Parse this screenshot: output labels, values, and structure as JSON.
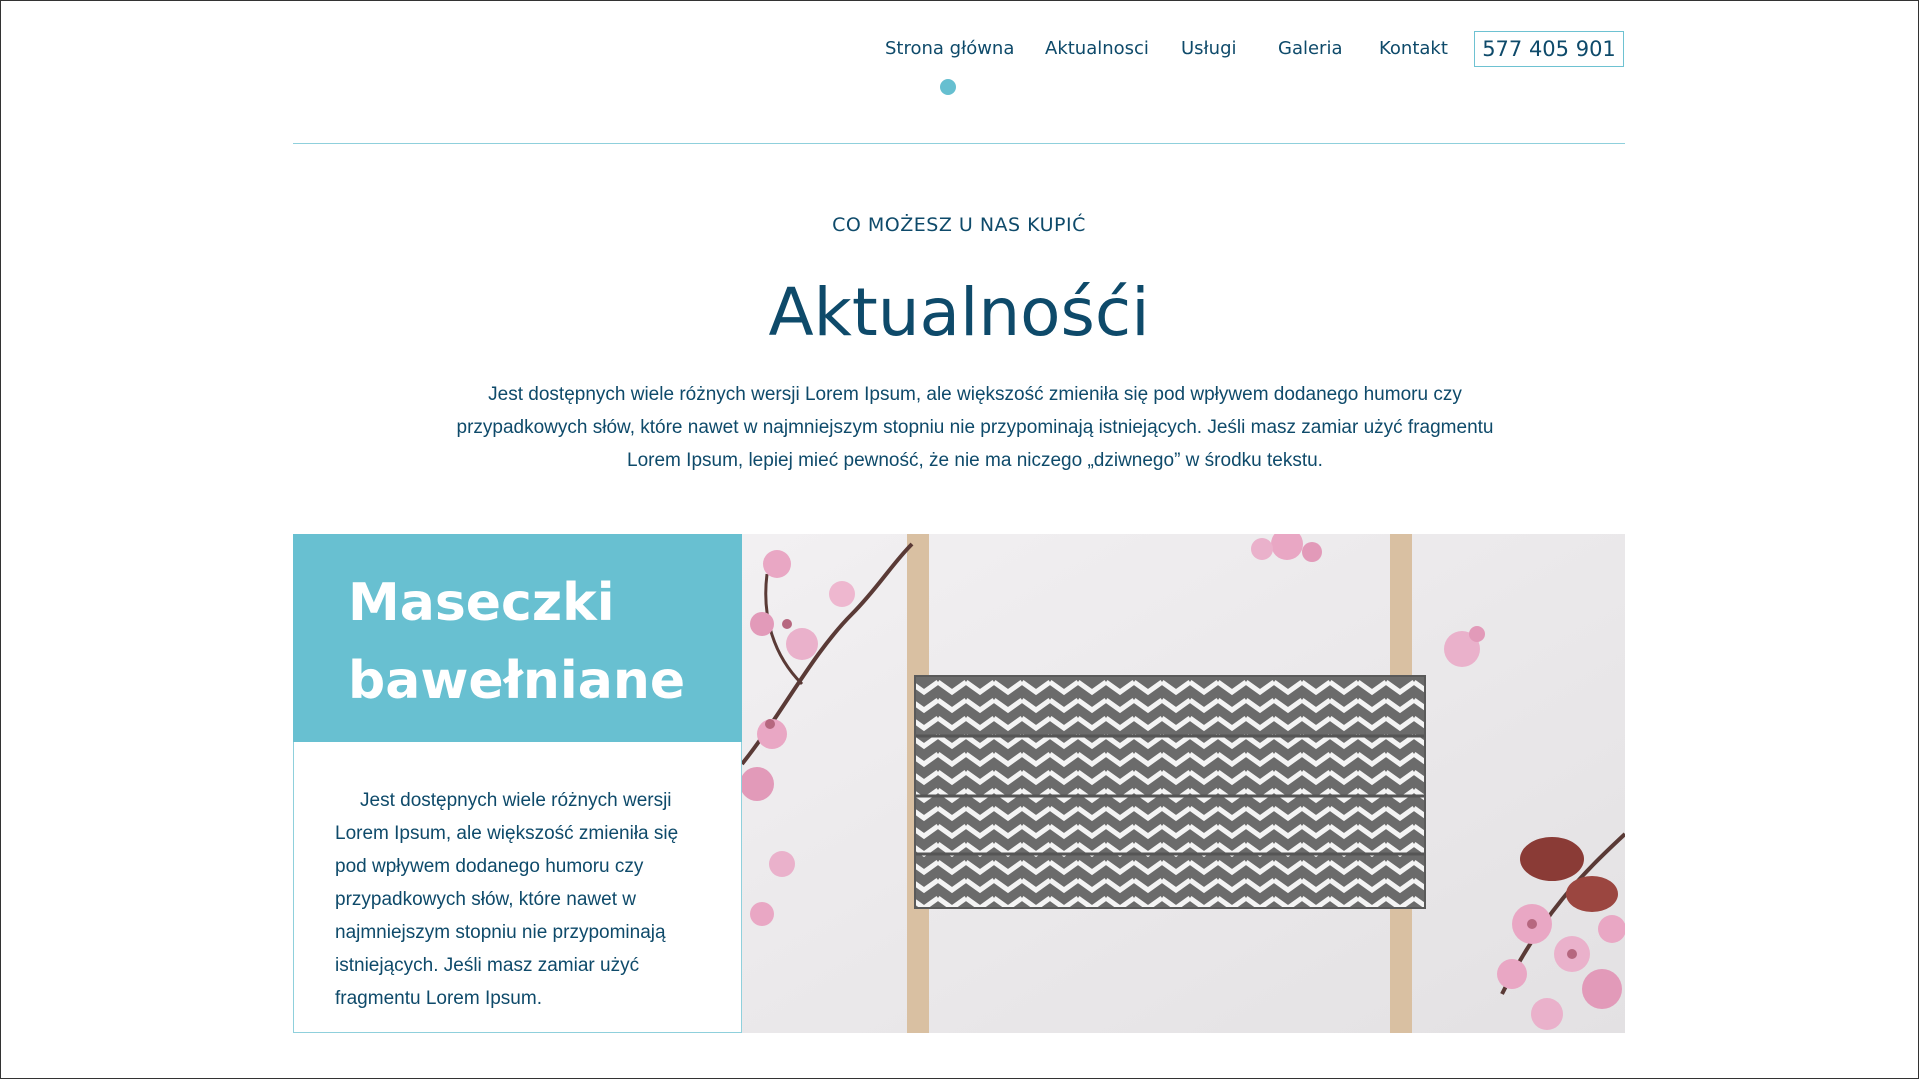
{
  "nav": {
    "items": [
      "Strona główna",
      "Aktualnosci",
      "Usługi",
      "Galeria",
      "Kontakt"
    ],
    "phone": "577 405 901",
    "active_index": 0
  },
  "intro": {
    "eyebrow": "CO MOŻESZ U NAS KUPIĆ",
    "title": "Aktualnośći",
    "text": "Jest dostępnych wiele różnych wersji Lorem Ipsum, ale większość zmieniła się pod wpływem dodanego humoru czy przypadkowych słów, które nawet w najmniejszym stopniu nie przypominają istniejących. Jeśli masz zamiar użyć fragmentu Lorem Ipsum, lepiej mieć pewność, że nie ma niczego „dziwnego” w środku tekstu."
  },
  "card": {
    "title": "Maseczki bawełniane",
    "text": "Jest dostępnych wiele różnych wersji Lorem Ipsum, ale większość zmieniła się pod wpływem dodanego humoru czy przypadkowych słów, które nawet w najmniejszym stopniu nie przypominają istniejących. Jeśli masz zamiar użyć fragmentu Lorem Ipsum."
  },
  "colors": {
    "primary_text": "#0e4a6a",
    "accent": "#68c0d1",
    "mask_gray": "#6b6b6b",
    "blossom": "#e9a7c4",
    "strap": "#d9c0a2"
  }
}
